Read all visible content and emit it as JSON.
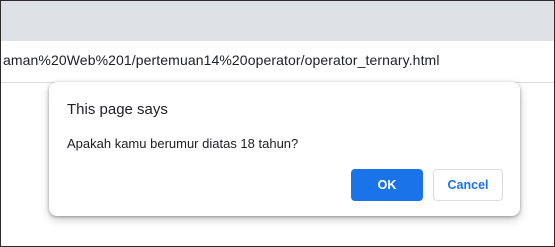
{
  "browser": {
    "address_bar_url": "aman%20Web%201/pertemuan14%20operator/operator_ternary.html"
  },
  "dialog": {
    "title": "This page says",
    "message": "Apakah kamu berumur diatas 18 tahun?",
    "ok_label": "OK",
    "cancel_label": "Cancel",
    "accent_color": "#1a73e8"
  }
}
